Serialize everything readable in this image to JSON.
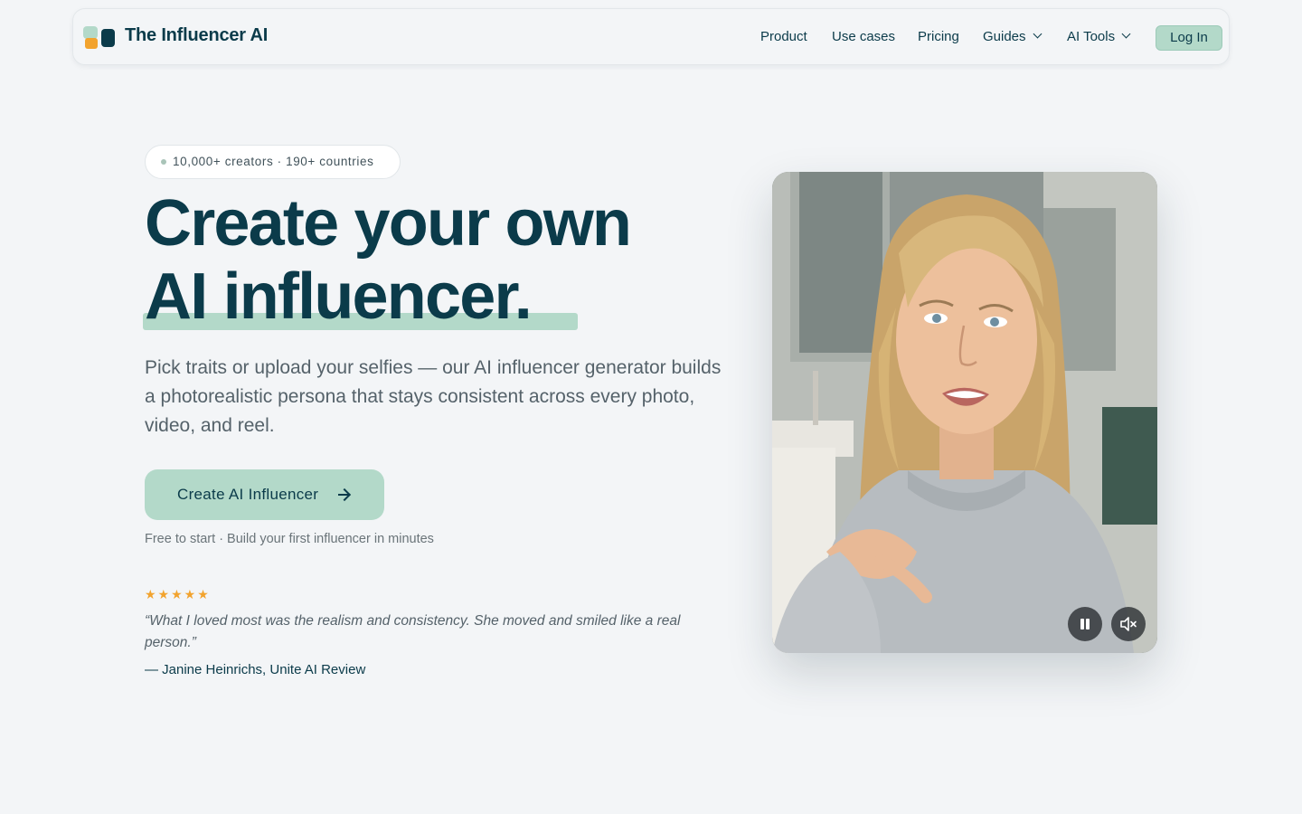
{
  "nav": {
    "brand": "The Influencer AI",
    "links": [
      "Product",
      "Use cases",
      "Pricing",
      "Guides",
      "AI Tools"
    ],
    "login": "Log In"
  },
  "hero": {
    "badge": "10,000+ creators · 190+ countries",
    "headline_line1": "Create your own",
    "headline_line2": "AI influencer.",
    "subtitle": "Pick traits or upload your selfies — our AI influencer generator builds a photorealistic persona that stays consistent across every photo, video, and reel.",
    "cta": "Create AI Influencer",
    "note": "Free to start · Build your first influencer in minutes",
    "rating": 5,
    "stars": "★★★★★",
    "quote": "“What I loved most was the realism and consistency. She moved and smiled like a real person.”",
    "author": "— Janine Heinrichs, Unite AI Review"
  },
  "video": {
    "controls": [
      "pause-button",
      "mute-button"
    ]
  },
  "colors": {
    "primary": "#0b3b4a",
    "accent": "#b3d9c9",
    "star": "#f2a32e",
    "background": "#f3f5f7"
  }
}
